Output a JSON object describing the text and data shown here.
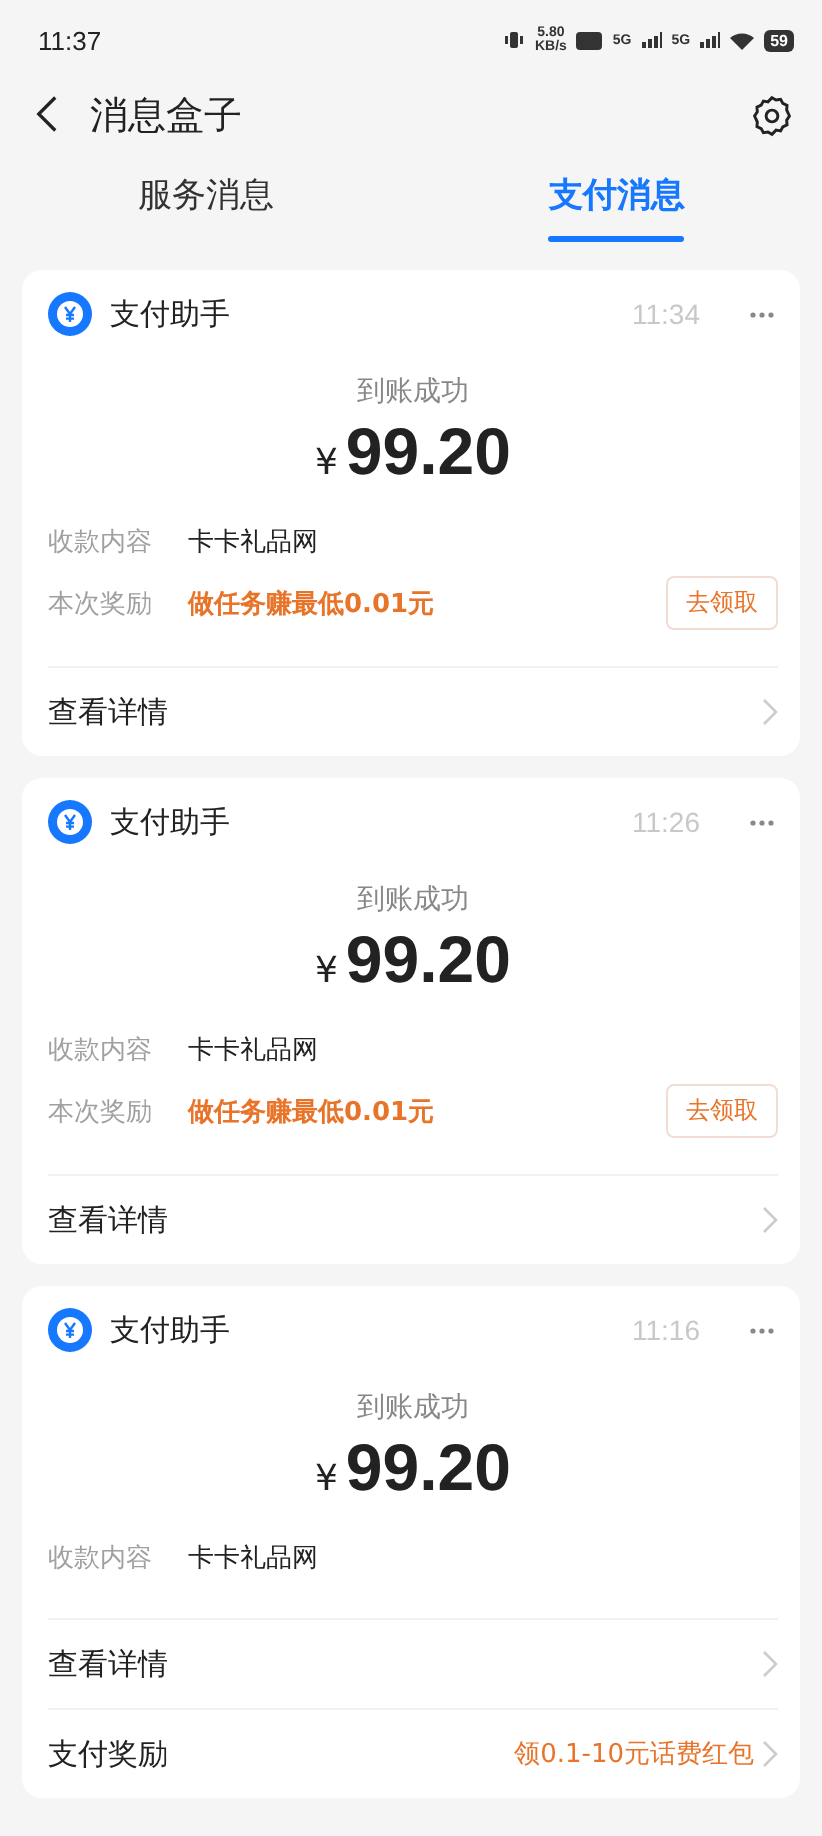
{
  "status_bar": {
    "time": "11:37",
    "net_speed": "5.80",
    "net_unit": "KB/s",
    "signals": [
      "5G",
      "5G"
    ],
    "battery": "59"
  },
  "header": {
    "title": "消息盒子"
  },
  "tabs": [
    {
      "label": "服务消息",
      "selected": false
    },
    {
      "label": "支付消息",
      "selected": true
    }
  ],
  "cards": [
    {
      "sender": "支付助手",
      "time": "11:34",
      "status": "到账成功",
      "currency": "¥",
      "amount": "99.20",
      "fields": [
        {
          "kind": "plain",
          "label": "收款内容",
          "value": "卡卡礼品网"
        },
        {
          "kind": "reward",
          "label": "本次奖励",
          "value": "做任务赚最低0.01元",
          "action": "去领取"
        }
      ],
      "links": [
        {
          "label": "查看详情"
        }
      ]
    },
    {
      "sender": "支付助手",
      "time": "11:26",
      "status": "到账成功",
      "currency": "¥",
      "amount": "99.20",
      "fields": [
        {
          "kind": "plain",
          "label": "收款内容",
          "value": "卡卡礼品网"
        },
        {
          "kind": "reward",
          "label": "本次奖励",
          "value": "做任务赚最低0.01元",
          "action": "去领取"
        }
      ],
      "links": [
        {
          "label": "查看详情"
        }
      ]
    },
    {
      "sender": "支付助手",
      "time": "11:16",
      "status": "到账成功",
      "currency": "¥",
      "amount": "99.20",
      "fields": [
        {
          "kind": "plain",
          "label": "收款内容",
          "value": "卡卡礼品网"
        }
      ],
      "links": [
        {
          "label": "查看详情"
        },
        {
          "label": "支付奖励",
          "value": "领0.1-10元话费红包"
        }
      ]
    }
  ]
}
